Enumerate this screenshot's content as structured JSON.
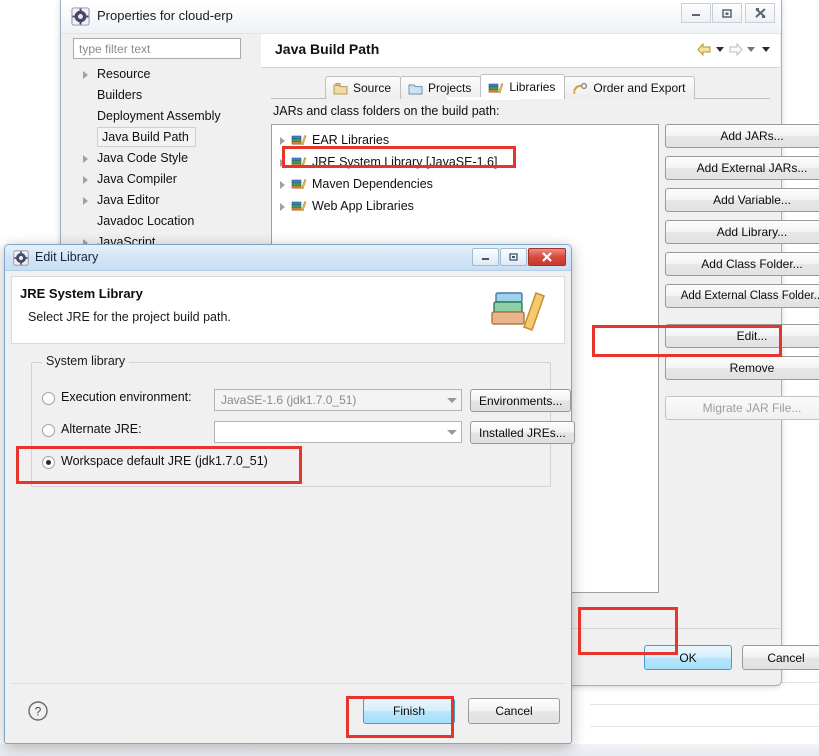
{
  "properties_window": {
    "title": "Properties for cloud-erp",
    "icon": "gear-icon",
    "window_buttons": [
      {
        "name": "minimize",
        "glyph": "—"
      },
      {
        "name": "maximize",
        "glyph": "□"
      },
      {
        "name": "close",
        "glyph": "✖"
      }
    ],
    "filter": {
      "placeholder": "type filter text",
      "value": ""
    },
    "tree": [
      {
        "label": "Resource",
        "expandable": true,
        "selected": false
      },
      {
        "label": "Builders",
        "expandable": false,
        "selected": false
      },
      {
        "label": "Deployment Assembly",
        "expandable": false,
        "selected": false
      },
      {
        "label": "Java Build Path",
        "expandable": false,
        "selected": true
      },
      {
        "label": "Java Code Style",
        "expandable": true,
        "selected": false
      },
      {
        "label": "Java Compiler",
        "expandable": true,
        "selected": false
      },
      {
        "label": "Java Editor",
        "expandable": true,
        "selected": false
      },
      {
        "label": "Javadoc Location",
        "expandable": false,
        "selected": false
      },
      {
        "label": "JavaScript",
        "expandable": true,
        "selected": false
      }
    ],
    "page_title": "Java Build Path",
    "nav": {
      "back": "back-arrow-icon",
      "back_menu": "back-dropdown-icon",
      "forward": "forward-arrow-icon",
      "forward_menu": "forward-dropdown-icon",
      "view_menu": "view-menu-icon"
    },
    "tabs": [
      {
        "label": "Source",
        "icon": "source-folder-icon",
        "active": false
      },
      {
        "label": "Projects",
        "icon": "projects-folder-icon",
        "active": false
      },
      {
        "label": "Libraries",
        "icon": "libraries-books-icon",
        "active": true
      },
      {
        "label": "Order and Export",
        "icon": "order-export-icon",
        "active": false
      }
    ],
    "list_label": "JARs and class folders on the build path:",
    "libraries": [
      {
        "label": "EAR Libraries",
        "icon": "library-books-icon",
        "expandable": true,
        "highlighted": false
      },
      {
        "label": "JRE System Library [JavaSE-1.6]",
        "icon": "library-books-icon",
        "expandable": true,
        "highlighted": true
      },
      {
        "label": "Maven Dependencies",
        "icon": "library-books-icon",
        "expandable": true,
        "highlighted": false
      },
      {
        "label": "Web App Libraries",
        "icon": "library-books-icon",
        "expandable": true,
        "highlighted": false
      }
    ],
    "side_buttons": [
      {
        "label": "Add JARs...",
        "mnemonic": "J",
        "disabled": false,
        "highlighted": false
      },
      {
        "label": "Add External JARs...",
        "mnemonic": "x",
        "disabled": false,
        "highlighted": false
      },
      {
        "label": "Add Variable...",
        "mnemonic": "V",
        "disabled": false,
        "highlighted": false
      },
      {
        "label": "Add Library...",
        "mnemonic": "a",
        "disabled": false,
        "highlighted": false
      },
      {
        "label": "Add Class Folder...",
        "mnemonic": "C",
        "disabled": false,
        "highlighted": false
      },
      {
        "label": "Add External Class Folder...",
        "mnemonic": "d",
        "disabled": false,
        "highlighted": false
      },
      {
        "label": "Edit...",
        "mnemonic": "E",
        "disabled": false,
        "highlighted": true
      },
      {
        "label": "Remove",
        "mnemonic": "R",
        "disabled": false,
        "highlighted": false
      },
      {
        "label": "Migrate JAR File...",
        "mnemonic": "M",
        "disabled": true,
        "highlighted": false
      }
    ],
    "ok_label": "OK",
    "cancel_label": "Cancel"
  },
  "edit_library_dialog": {
    "title": "Edit Library",
    "icon": "gear-icon",
    "window_buttons": [
      {
        "name": "minimize",
        "glyph": "—"
      },
      {
        "name": "maximize",
        "glyph": "□"
      },
      {
        "name": "close",
        "glyph": "✖"
      }
    ],
    "header_title": "JRE System Library",
    "header_subtitle": "Select JRE for the project build path.",
    "header_icon": "books-icon",
    "group_legend": "System library",
    "options": [
      {
        "label": "Execution environment:",
        "selected": false,
        "combo_value": "JavaSE-1.6 (jdk1.7.0_51)",
        "combo_enabled": false,
        "button": "Environments...",
        "highlighted": false
      },
      {
        "label": "Alternate JRE:",
        "selected": false,
        "combo_value": "",
        "combo_enabled": true,
        "button": "Installed JREs...",
        "highlighted": false
      },
      {
        "label": "Workspace default JRE (jdk1.7.0_51)",
        "selected": true,
        "combo_value": null,
        "button": null,
        "highlighted": true
      }
    ],
    "help_icon": "help-question-icon",
    "finish_label": "Finish",
    "cancel_label": "Cancel"
  },
  "annotations": {
    "highlight_color": "#e8352b",
    "boxes": [
      "jre-system-library-row",
      "edit-button",
      "ok-button",
      "workspace-default-jre-radio",
      "finish-button"
    ]
  }
}
